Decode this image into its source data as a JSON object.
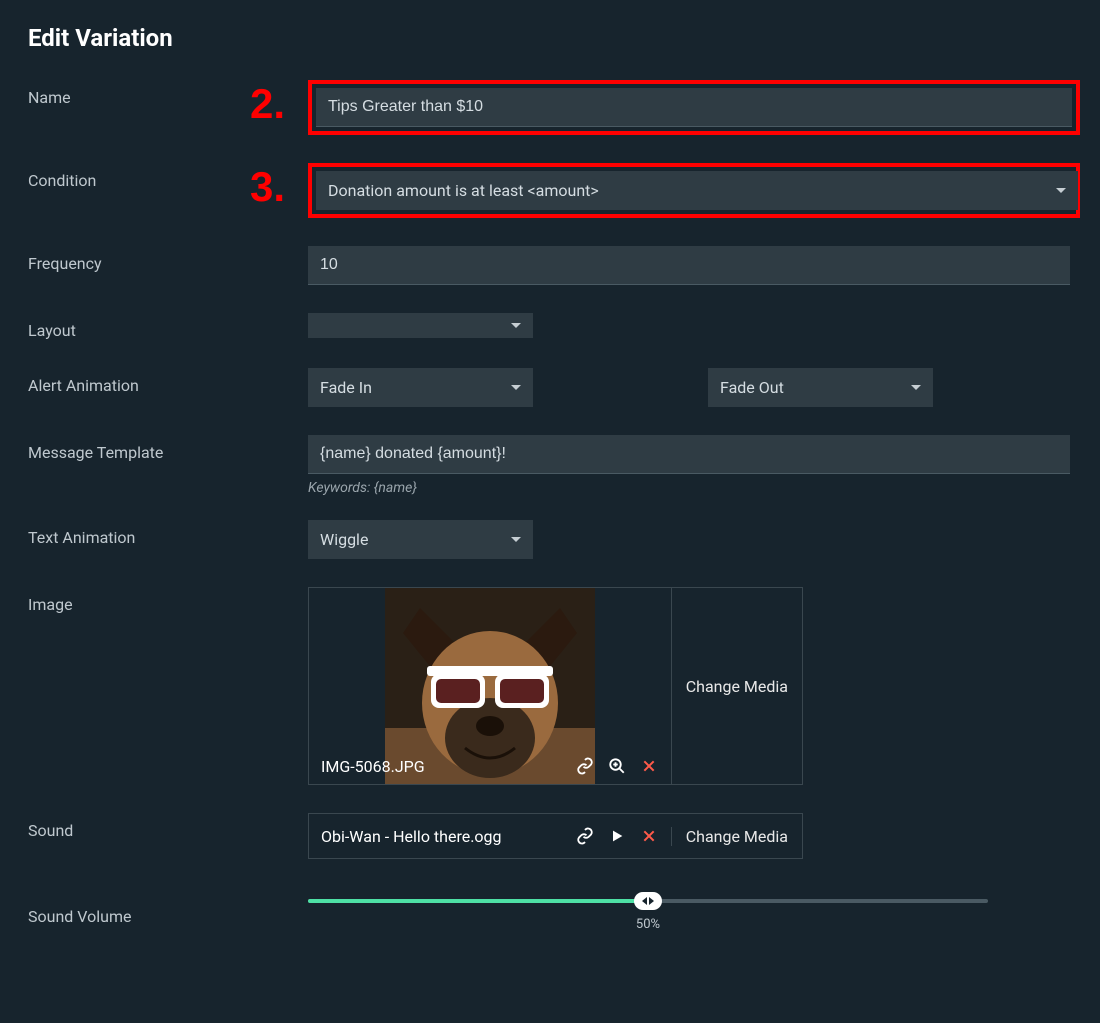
{
  "title": "Edit Variation",
  "steps": {
    "s2": "2.",
    "s3": "3."
  },
  "fields": {
    "name_label": "Name",
    "name_value": "Tips Greater than $10",
    "condition_label": "Condition",
    "condition_value": "Donation amount is at least <amount>",
    "frequency_label": "Frequency",
    "frequency_value": "10",
    "layout_label": "Layout",
    "layout_value": "",
    "alert_anim_label": "Alert Animation",
    "alert_anim_in": "Fade In",
    "alert_anim_out": "Fade Out",
    "msg_template_label": "Message Template",
    "msg_template_value": "{name} donated {amount}!",
    "keywords_hint": "Keywords: {name}",
    "text_anim_label": "Text Animation",
    "text_anim_value": "Wiggle",
    "image_label": "Image",
    "image_filename": "IMG-5068.JPG",
    "change_media": "Change Media",
    "sound_label": "Sound",
    "sound_filename": "Obi-Wan - Hello there.ogg",
    "volume_label": "Sound Volume",
    "volume_pct": 50,
    "volume_text": "50%"
  }
}
